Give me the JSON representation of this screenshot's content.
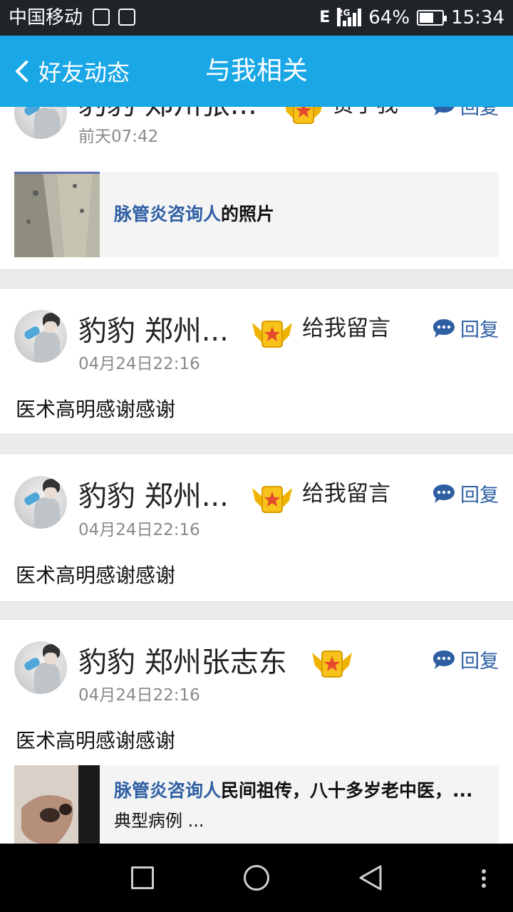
{
  "status_bar": {
    "carrier": "中国移动",
    "network_letter": "E",
    "network_gen": "2G",
    "battery_percent": "64%",
    "battery_level": 0.64,
    "time": "15:34"
  },
  "nav": {
    "back_label": "好友动态",
    "title": "与我相关"
  },
  "colors": {
    "nav_bg": "#1aa7e6",
    "link": "#2e5fa3",
    "badge_gold": "#f0b400"
  },
  "feed": [
    {
      "name": "豹豹  郑州张...",
      "action": "赞了我",
      "time": "前天07:42",
      "reply_label": "回复",
      "share": {
        "link": "脉管炎咨询人",
        "text": "的照片"
      }
    },
    {
      "name": "豹豹  郑州...",
      "action": "给我留言",
      "time": "04月24日22:16",
      "reply_label": "回复",
      "content": "医术高明感谢感谢"
    },
    {
      "name": "豹豹  郑州...",
      "action": "给我留言",
      "time": "04月24日22:16",
      "reply_label": "回复",
      "content": "医术高明感谢感谢"
    },
    {
      "name": "豹豹  郑州张志东",
      "time": "04月24日22:16",
      "reply_label": "回复",
      "content": "医术高明感谢感谢",
      "share": {
        "link": "脉管炎咨询人",
        "text": "民间祖传，八十多岁老中医，...",
        "text2": "典型病例 ..."
      }
    }
  ],
  "icons": {
    "back": "chevron-left-icon",
    "badge": "vip-crown-badge-icon",
    "reply": "chat-bubble-icon",
    "sys_recent": "square-icon",
    "sys_home": "circle-icon",
    "sys_back": "triangle-back-icon",
    "sys_more": "more-dots-icon"
  }
}
